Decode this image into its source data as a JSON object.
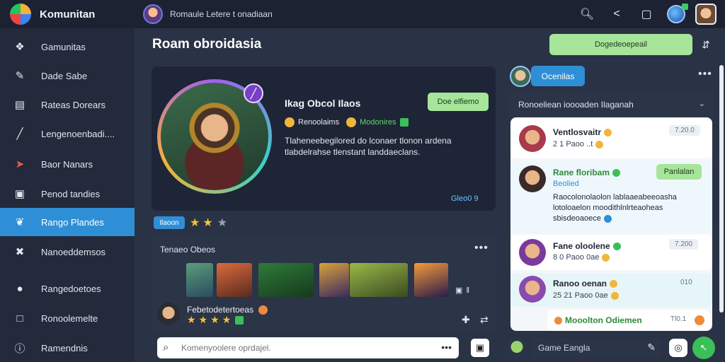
{
  "app": {
    "name": "Komunitan"
  },
  "top_user": {
    "text": "Romaule  Letere t onadiaan"
  },
  "top_icons": [
    "search-icon",
    "share-icon",
    "chat-icon",
    "globe-icon",
    "profile-icon"
  ],
  "sidebar": {
    "items": [
      {
        "label": "Gamunitas",
        "icon": "puzzle-icon"
      },
      {
        "label": "Dade Sabe",
        "icon": "wrench-icon"
      },
      {
        "label": "Rateas Dorears",
        "icon": "calendar-icon"
      },
      {
        "label": "Lengenoenbadi....",
        "icon": "chart-icon"
      },
      {
        "label": "Baor Nanars",
        "icon": "plane-icon"
      },
      {
        "label": "Penod tandies",
        "icon": "card-icon"
      },
      {
        "label": "Rango Plandes",
        "icon": "leaf-icon",
        "active": true
      },
      {
        "label": "Nanoeddemsos",
        "icon": "tools-icon"
      },
      {
        "label": "Rangedoetoes",
        "icon": "user-icon"
      },
      {
        "label": "Ronoolemelte",
        "icon": "square-icon"
      },
      {
        "label": "Ramendnis",
        "icon": "info-icon"
      }
    ]
  },
  "main": {
    "title": "Roam obroidasia",
    "profile": {
      "name": "Ikag Obcol Ilaos",
      "tag_button": "Doe elfiemo",
      "coins_label": "Renoolaims",
      "rank_label": "Modonires",
      "description": "Tlaheneebegilored do lconaer tlonon ardena tlabdelrahse tlenstant landdaeclans.",
      "link": "Gleo0 9"
    },
    "badge": "Ilaoon",
    "rating": {
      "value": 2,
      "max": 3
    },
    "games": {
      "title": "Tenaeo Obeos",
      "thumb_count": 6,
      "user_name": "Febetodetertoeas"
    },
    "search": {
      "placeholder": "Komenyoolere oprdajel."
    }
  },
  "right": {
    "top_button": "Dogedeoepeail",
    "chip": "Ocenilas",
    "dropdown": "Ronoeliean ioooaden Ilaganah",
    "messages": [
      {
        "name": "Ventlosvaitr",
        "sub": "2 1 Paoo  ..t",
        "time": "7.20.0"
      },
      {
        "name": "Rane floribam",
        "sub": "Beolied",
        "button": "Panlalan",
        "body": "Raocolonolaolon lablaaeabeeoasha lotoloaelon moodithlnlrteaoheas sbisdeoaoece"
      },
      {
        "name": "Fane oloolene",
        "sub": "8 0 Paoo 0ae",
        "time": "7.200"
      },
      {
        "name": "Ranoo oenan",
        "sub": "25 21 Paoo 0ae",
        "time": "010"
      },
      {
        "name": "Mooolton Odiemen",
        "time": "Tl0.1"
      }
    ],
    "chat": {
      "placeholder": "Game Eangla"
    }
  },
  "colors": {
    "accent": "#2f8fd6",
    "action_green": "#a6e59a",
    "background": "#2a3245"
  }
}
